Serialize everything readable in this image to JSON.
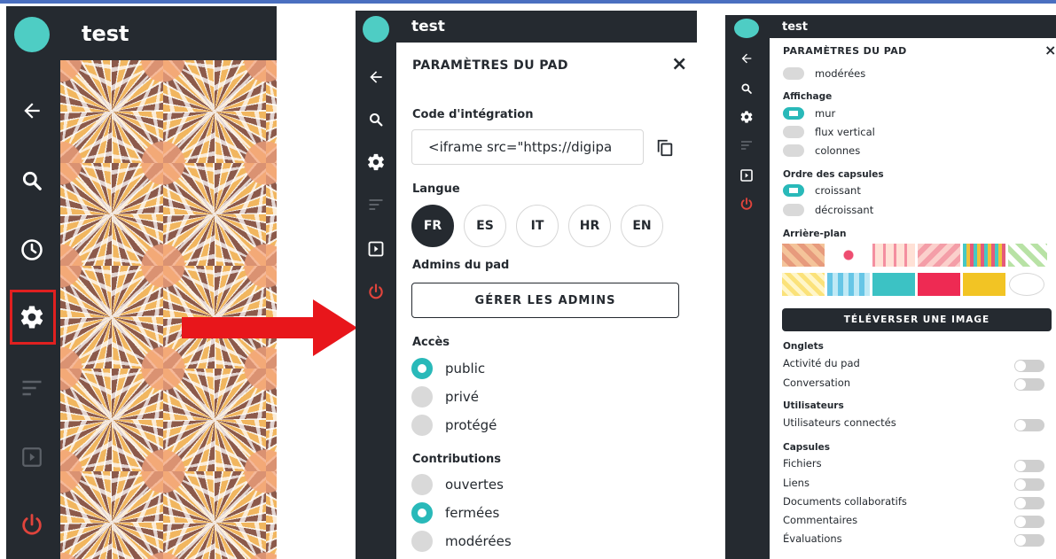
{
  "pad": {
    "title": "test"
  },
  "panel": {
    "title": "PARAMÈTRES DU PAD",
    "close": "×",
    "embed": {
      "label": "Code d'intégration",
      "value": "<iframe src=\"https://digipa"
    },
    "language": {
      "label": "Langue",
      "options": [
        "FR",
        "ES",
        "IT",
        "HR",
        "EN"
      ],
      "selected": "FR"
    },
    "admins": {
      "label": "Admins du pad",
      "button": "GÉRER LES ADMINS"
    },
    "access": {
      "label": "Accès",
      "options": [
        "public",
        "privé",
        "protégé"
      ],
      "selected": "public"
    },
    "contributions": {
      "label": "Contributions",
      "options": [
        "ouvertes",
        "fermées",
        "modérées"
      ],
      "selected": "fermées"
    },
    "display": {
      "label": "Affichage",
      "options": [
        "mur",
        "flux vertical",
        "colonnes"
      ],
      "selected": "mur"
    },
    "order": {
      "label": "Ordre des capsules",
      "options": [
        "croissant",
        "décroissant"
      ],
      "selected": "croissant"
    },
    "background": {
      "label": "Arrière-plan",
      "upload_button": "TÉLÉVERSER UNE IMAGE",
      "solid_colors": [
        "#3cc2c4",
        "#ee2a53",
        "#f2c424",
        "#ffffff"
      ]
    },
    "tabs": {
      "label": "Onglets",
      "items": [
        "Activité du pad",
        "Conversation"
      ]
    },
    "users": {
      "label": "Utilisateurs",
      "items": [
        "Utilisateurs connectés"
      ]
    },
    "capsules": {
      "label": "Capsules",
      "items": [
        "Fichiers",
        "Liens",
        "Documents collaboratifs",
        "Commentaires",
        "Évaluations"
      ]
    }
  },
  "colors": {
    "dark": "#252a30",
    "accent": "#4ecdc4",
    "arrow": "#e8161b",
    "highlight": "#e02020",
    "power": "#e0443c"
  },
  "icons": [
    "back-arrow-icon",
    "search-icon",
    "history-icon",
    "gear-icon",
    "sort-icon",
    "present-icon",
    "power-icon",
    "copy-icon",
    "close-icon"
  ]
}
